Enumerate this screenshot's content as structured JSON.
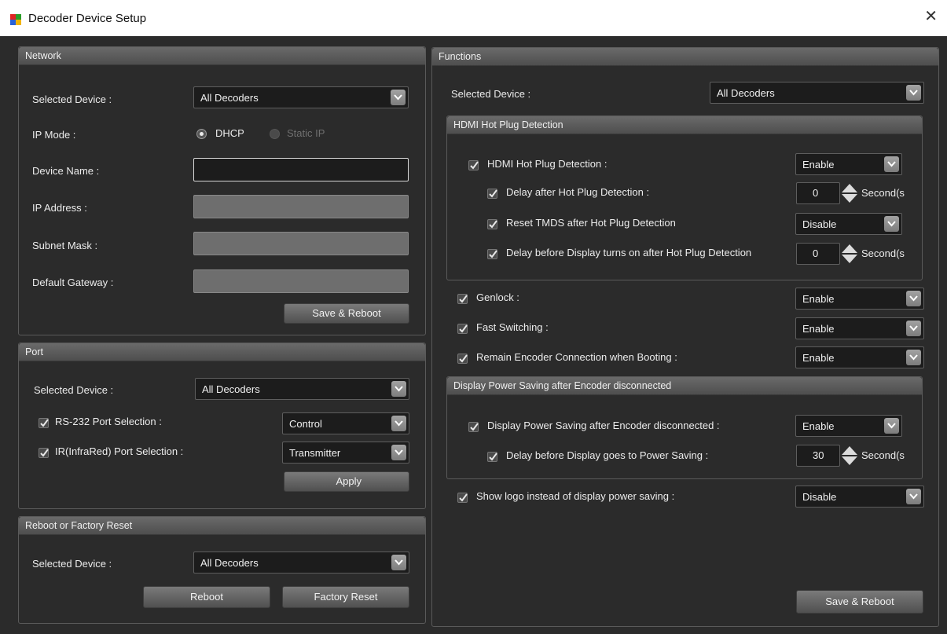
{
  "window": {
    "title": "Decoder Device Setup"
  },
  "network": {
    "header": "Network",
    "selected_device_label": "Selected Device :",
    "selected_device_value": "All Decoders",
    "ip_mode_label": "IP Mode :",
    "dhcp_label": "DHCP",
    "static_ip_label": "Static IP",
    "device_name_label": "Device Name :",
    "ip_address_label": "IP Address :",
    "subnet_mask_label": "Subnet Mask :",
    "default_gateway_label": "Default Gateway :",
    "save_reboot_label": "Save & Reboot"
  },
  "port": {
    "header": "Port",
    "selected_device_label": "Selected Device :",
    "selected_device_value": "All Decoders",
    "rs232_label": "RS-232 Port Selection :",
    "rs232_value": "Control",
    "ir_label": "IR(InfraRed) Port Selection :",
    "ir_value": "Transmitter",
    "apply_label": "Apply"
  },
  "reset": {
    "header": "Reboot or Factory Reset",
    "selected_device_label": "Selected Device :",
    "selected_device_value": "All Decoders",
    "reboot_label": "Reboot",
    "factory_reset_label": "Factory Reset"
  },
  "functions": {
    "header": "Functions",
    "selected_device_label": "Selected Device :",
    "selected_device_value": "All Decoders",
    "hotplug": {
      "header": "HDMI Hot Plug Detection",
      "detection_label": "HDMI Hot Plug Detection :",
      "detection_value": "Enable",
      "delay_after_label": "Delay after Hot Plug Detection :",
      "delay_after_value": "0",
      "reset_tmds_label": "Reset TMDS after Hot Plug Detection",
      "reset_tmds_value": "Disable",
      "delay_before_label": "Delay before Display turns on after Hot Plug Detection",
      "delay_before_value": "0",
      "unit": "Second(s"
    },
    "genlock_label": "Genlock :",
    "genlock_value": "Enable",
    "fast_switching_label": "Fast Switching :",
    "fast_switching_value": "Enable",
    "remain_label": "Remain Encoder Connection when Booting :",
    "remain_value": "Enable",
    "power_saving": {
      "header": "Display Power Saving after Encoder disconnected",
      "enable_label": "Display Power Saving after Encoder disconnected :",
      "enable_value": "Enable",
      "delay_label": "Delay before Display goes to Power Saving :",
      "delay_value": "30",
      "unit": "Second(s"
    },
    "show_logo_label": "Show logo instead of display power saving :",
    "show_logo_value": "Disable",
    "save_reboot_label": "Save & Reboot"
  }
}
